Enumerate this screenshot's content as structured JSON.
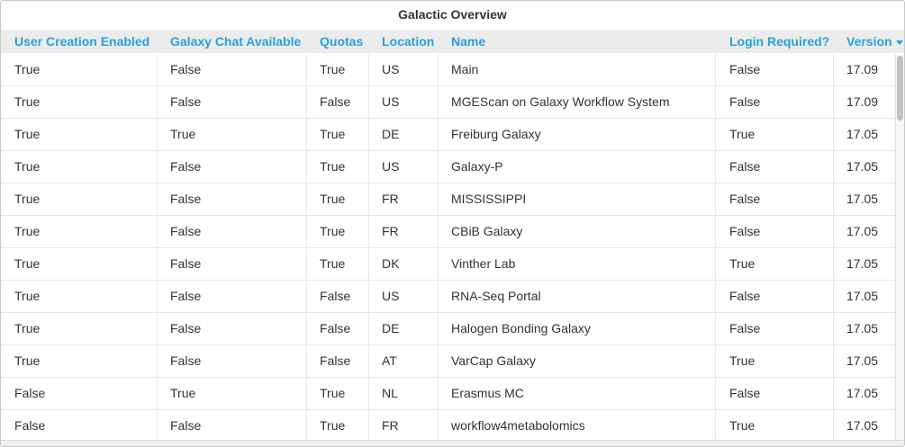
{
  "title": "Galactic Overview",
  "columns": {
    "user_creation": "User Creation Enabled",
    "galaxy_chat": "Galaxy Chat Available",
    "quotas": "Quotas",
    "location": "Location",
    "name": "Name",
    "login_required": "Login Required?",
    "version": "Version"
  },
  "sort": {
    "column": "version",
    "direction": "descending"
  },
  "rows": [
    {
      "user_creation": "True",
      "galaxy_chat": "False",
      "quotas": "True",
      "location": "US",
      "name": "Main",
      "login_required": "False",
      "version": "17.09"
    },
    {
      "user_creation": "True",
      "galaxy_chat": "False",
      "quotas": "False",
      "location": "US",
      "name": "MGEScan on Galaxy Workflow System",
      "login_required": "False",
      "version": "17.09"
    },
    {
      "user_creation": "True",
      "galaxy_chat": "True",
      "quotas": "True",
      "location": "DE",
      "name": "Freiburg Galaxy",
      "login_required": "True",
      "version": "17.05"
    },
    {
      "user_creation": "True",
      "galaxy_chat": "False",
      "quotas": "True",
      "location": "US",
      "name": "Galaxy-P",
      "login_required": "False",
      "version": "17.05"
    },
    {
      "user_creation": "True",
      "galaxy_chat": "False",
      "quotas": "True",
      "location": "FR",
      "name": "MISSISSIPPI",
      "login_required": "False",
      "version": "17.05"
    },
    {
      "user_creation": "True",
      "galaxy_chat": "False",
      "quotas": "True",
      "location": "FR",
      "name": "CBiB Galaxy",
      "login_required": "False",
      "version": "17.05"
    },
    {
      "user_creation": "True",
      "galaxy_chat": "False",
      "quotas": "True",
      "location": "DK",
      "name": "Vinther Lab",
      "login_required": "True",
      "version": "17.05"
    },
    {
      "user_creation": "True",
      "galaxy_chat": "False",
      "quotas": "False",
      "location": "US",
      "name": "RNA-Seq Portal",
      "login_required": "False",
      "version": "17.05"
    },
    {
      "user_creation": "True",
      "galaxy_chat": "False",
      "quotas": "False",
      "location": "DE",
      "name": "Halogen Bonding Galaxy",
      "login_required": "False",
      "version": "17.05"
    },
    {
      "user_creation": "True",
      "galaxy_chat": "False",
      "quotas": "False",
      "location": "AT",
      "name": "VarCap Galaxy",
      "login_required": "True",
      "version": "17.05"
    },
    {
      "user_creation": "False",
      "galaxy_chat": "True",
      "quotas": "True",
      "location": "NL",
      "name": "Erasmus MC",
      "login_required": "False",
      "version": "17.05"
    },
    {
      "user_creation": "False",
      "galaxy_chat": "False",
      "quotas": "True",
      "location": "FR",
      "name": "workflow4metabolomics",
      "login_required": "True",
      "version": "17.05"
    }
  ],
  "colors": {
    "header_text": "#27a3da",
    "header_bg": "#ececec",
    "text": "#333333"
  }
}
